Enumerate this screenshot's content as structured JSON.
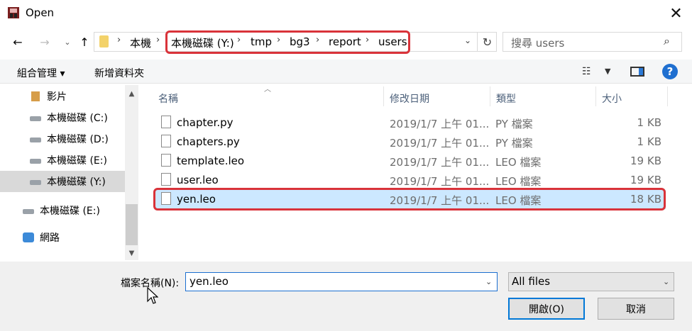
{
  "window": {
    "title": "Open"
  },
  "nav": {
    "breadcrumb": [
      "本機",
      "本機磁碟 (Y:)",
      "tmp",
      "bg3",
      "report",
      "users"
    ],
    "search_placeholder": "搜尋 users"
  },
  "toolbar": {
    "organize_label": "組合管理 ▾",
    "new_folder_label": "新增資料夾"
  },
  "sidebar": {
    "items": [
      {
        "label": "影片",
        "icon": "video-folder-icon"
      },
      {
        "label": "本機磁碟 (C:)",
        "icon": "drive-icon"
      },
      {
        "label": "本機磁碟 (D:)",
        "icon": "drive-icon"
      },
      {
        "label": "本機磁碟 (E:)",
        "icon": "drive-icon"
      },
      {
        "label": "本機磁碟 (Y:)",
        "icon": "drive-icon",
        "selected": true
      },
      {
        "label": "本機磁碟 (E:)",
        "icon": "drive-icon"
      },
      {
        "label": "網路",
        "icon": "network-icon"
      }
    ]
  },
  "columns": {
    "name": "名稱",
    "date": "修改日期",
    "type": "類型",
    "size": "大小"
  },
  "files": [
    {
      "name": "chapter.py",
      "date": "2019/1/7 上午 01...",
      "type": "PY 檔案",
      "size": "1 KB"
    },
    {
      "name": "chapters.py",
      "date": "2019/1/7 上午 01...",
      "type": "PY 檔案",
      "size": "1 KB"
    },
    {
      "name": "template.leo",
      "date": "2019/1/7 上午 01...",
      "type": "LEO 檔案",
      "size": "19 KB"
    },
    {
      "name": "user.leo",
      "date": "2019/1/7 上午 01...",
      "type": "LEO 檔案",
      "size": "19 KB"
    },
    {
      "name": "yen.leo",
      "date": "2019/1/7 上午 01...",
      "type": "LEO 檔案",
      "size": "18 KB",
      "selected": true
    }
  ],
  "footer": {
    "filename_label": "檔案名稱(N):",
    "filename_value": "yen.leo",
    "filetype_value": "All files",
    "open_label": "開啟(O)",
    "cancel_label": "取消"
  },
  "colors": {
    "highlight": "#d9333a",
    "selection": "#cce8ff",
    "accent": "#0078d7"
  }
}
